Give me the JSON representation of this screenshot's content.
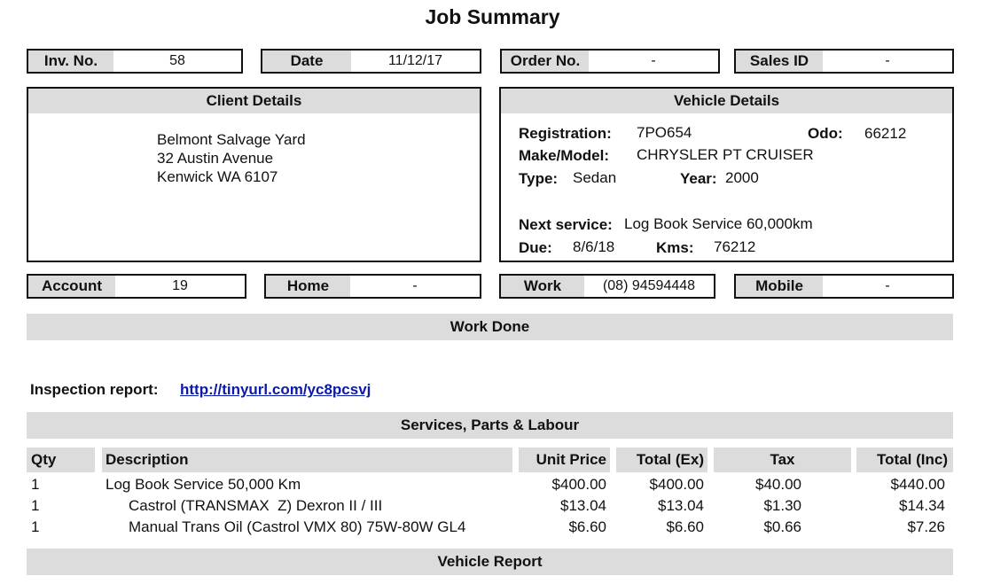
{
  "title": "Job Summary",
  "header": {
    "inv_label": "Inv. No.",
    "inv_value": "58",
    "date_label": "Date",
    "date_value": "11/12/17",
    "order_label": "Order No.",
    "order_value": "-",
    "sales_label": "Sales ID",
    "sales_value": "-"
  },
  "client": {
    "heading": "Client Details",
    "lines": [
      "Belmont Salvage Yard",
      "32 Austin Avenue",
      "Kenwick WA 6107"
    ]
  },
  "vehicle": {
    "heading": "Vehicle Details",
    "registration_label": "Registration:",
    "registration": "7PO654",
    "odo_label": "Odo:",
    "odo": "66212",
    "make_label": "Make/Model:",
    "make": "CHRYSLER PT CRUISER",
    "type_label": "Type:",
    "type": "Sedan",
    "year_label": "Year:",
    "year": "2000",
    "next_service_label": "Next service:",
    "next_service": "Log Book Service 60,000km",
    "due_label": "Due:",
    "due": "8/6/18",
    "kms_label": "Kms:",
    "kms": "76212"
  },
  "contacts": {
    "account_label": "Account",
    "account_value": "19",
    "home_label": "Home",
    "home_value": "-",
    "work_label": "Work",
    "work_value": "(08) 94594448",
    "mobile_label": "Mobile",
    "mobile_value": "-"
  },
  "work_done": {
    "heading": "Work Done"
  },
  "inspection": {
    "label": "Inspection report:",
    "link": "http://tinyurl.com/yc8pcsvj"
  },
  "services": {
    "heading": "Services, Parts & Labour",
    "columns": [
      "Qty",
      "Description",
      "Unit Price",
      "Total (Ex)",
      "Tax",
      "Total (Inc)"
    ],
    "rows": [
      {
        "qty": "1",
        "desc": "Log Book Service 50,000 Km",
        "unit": "$400.00",
        "ex": "$400.00",
        "tax": "$40.00",
        "inc": "$440.00",
        "indent": false
      },
      {
        "qty": "1",
        "desc": "Castrol (TRANSMAX  Z) Dexron II / III",
        "unit": "$13.04",
        "ex": "$13.04",
        "tax": "$1.30",
        "inc": "$14.34",
        "indent": true
      },
      {
        "qty": "1",
        "desc": "Manual Trans Oil (Castrol VMX 80) 75W-80W GL4",
        "unit": "$6.60",
        "ex": "$6.60",
        "tax": "$0.66",
        "inc": "$7.26",
        "indent": true
      }
    ]
  },
  "vehicle_report": {
    "heading": "Vehicle Report"
  }
}
